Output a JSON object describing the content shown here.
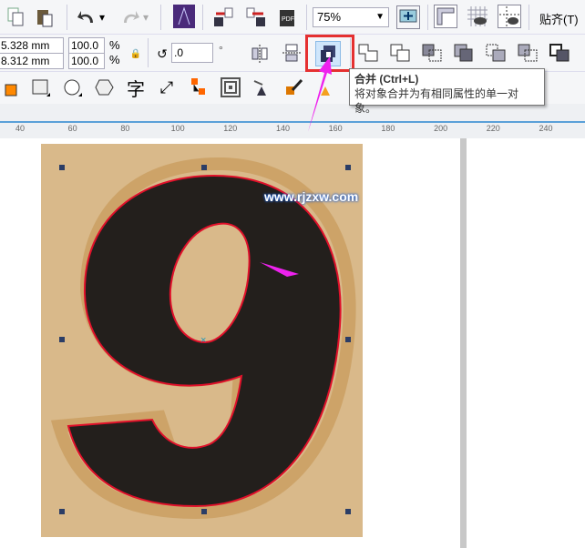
{
  "toolbar": {
    "zoom": "75%",
    "snap_label": "贴齐(T)"
  },
  "property_bar": {
    "width": "5.328 mm",
    "height": "8.312 mm",
    "scale_x": "100.0",
    "scale_y": "100.0",
    "percent": "%",
    "rotation": ".0",
    "degree": "°"
  },
  "tooltip": {
    "title": "合并 (Ctrl+L)",
    "description": "将对象合并为有相同属性的单一对象。"
  },
  "ruler": {
    "ticks": [
      "40",
      "60",
      "80",
      "100",
      "120",
      "140",
      "160",
      "180",
      "200",
      "220",
      "240"
    ]
  },
  "watermark": "www.rjzxw.com",
  "colors": {
    "highlight": "#e53030",
    "arrow": "#ee22ee",
    "fill": "#231f1c",
    "outline": "#e0102a"
  }
}
